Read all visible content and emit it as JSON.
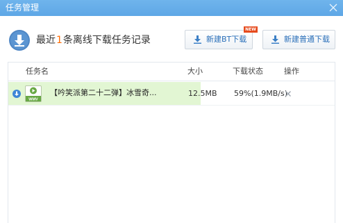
{
  "window": {
    "title": "任务管理",
    "close_icon": "close-icon"
  },
  "header": {
    "avatar_icon": "download-avatar-icon",
    "prefix": "最近",
    "count": "1",
    "suffix": "条离线下载任务记录",
    "count_color": "#ff6a00",
    "new_badge": "NEW",
    "buttons": {
      "bt_label": "新建BT下载",
      "normal_label": "新建普通下载",
      "icon": "download-arrow-icon"
    }
  },
  "table": {
    "columns": {
      "name": "任务名",
      "size": "大小",
      "status": "下载状态",
      "action": "操作"
    },
    "rows": [
      {
        "status_icon": "downloading-icon",
        "file_icon": "wmv-file-icon",
        "file_type": "WMV",
        "name": "【吟笑派第二十二弹】冰雪奇...",
        "size": "12.5MB",
        "status": "59%(1.9MB/s)",
        "progress_percent": 59,
        "delete_icon": "delete-x-icon"
      }
    ]
  },
  "colors": {
    "titlebar": "#5ea7e6",
    "progress_fill": "#e2f6d3",
    "accent_blue": "#2a6fb9",
    "badge_red": "#e64b1e"
  }
}
